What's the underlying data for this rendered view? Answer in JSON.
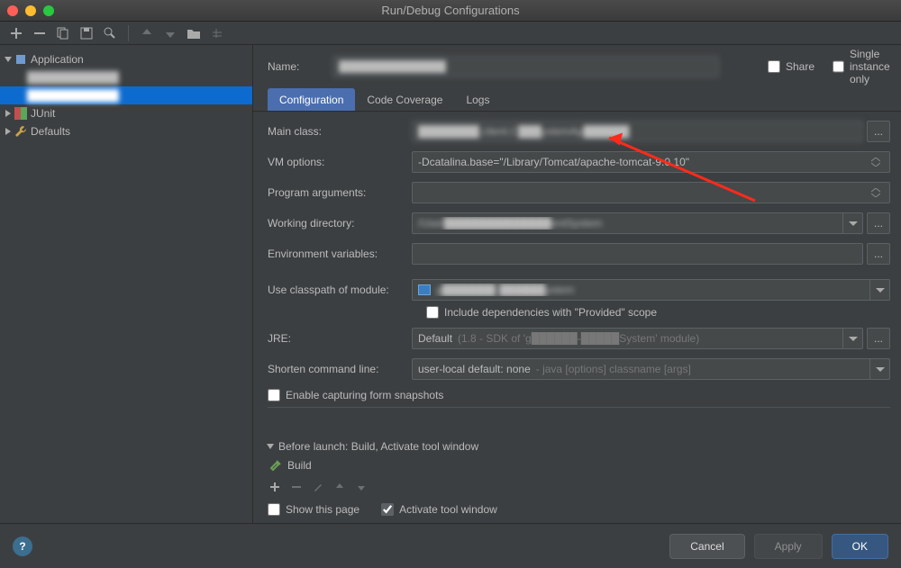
{
  "window": {
    "title": "Run/Debug Configurations"
  },
  "tree": {
    "app_group": "Application",
    "item1": "████████████",
    "item2": "████████████",
    "junit": "JUnit",
    "defaults": "Defaults"
  },
  "form": {
    "name_label": "Name:",
    "name_value": "██████████████",
    "share": "Share",
    "single_instance": "Single instance only",
    "tabs": {
      "config": "Configuration",
      "coverage": "Code Coverage",
      "logs": "Logs"
    },
    "main_class_label": "Main class:",
    "main_class_value": "████████.client.C███ystemAp██████",
    "vm_label": "VM options:",
    "vm_value": "-Dcatalina.base=\"/Library/Tomcat/apache-tomcat-9.0.10\"",
    "prog_label": "Program arguments:",
    "prog_value": "",
    "wd_label": "Working directory:",
    "wd_value": "/User██████████████entSystem",
    "env_label": "Environment variables:",
    "env_value": "",
    "classpath_label": "Use classpath of module:",
    "classpath_value": "g███████-██████ystem",
    "include_deps": "Include dependencies with \"Provided\" scope",
    "jre_label": "JRE:",
    "jre_value": "Default",
    "jre_hint": " (1.8 - SDK of 'g██████-█████System' module)",
    "shorten_label": "Shorten command line:",
    "shorten_value": "user-local default: none",
    "shorten_hint": " - java [options] classname [args]",
    "snapshots": "Enable capturing form snapshots"
  },
  "before": {
    "header": "Before launch: Build, Activate tool window",
    "build": "Build",
    "show_page": "Show this page",
    "activate": "Activate tool window"
  },
  "buttons": {
    "cancel": "Cancel",
    "apply": "Apply",
    "ok": "OK"
  },
  "misc": {
    "dots": "...",
    "help": "?"
  }
}
